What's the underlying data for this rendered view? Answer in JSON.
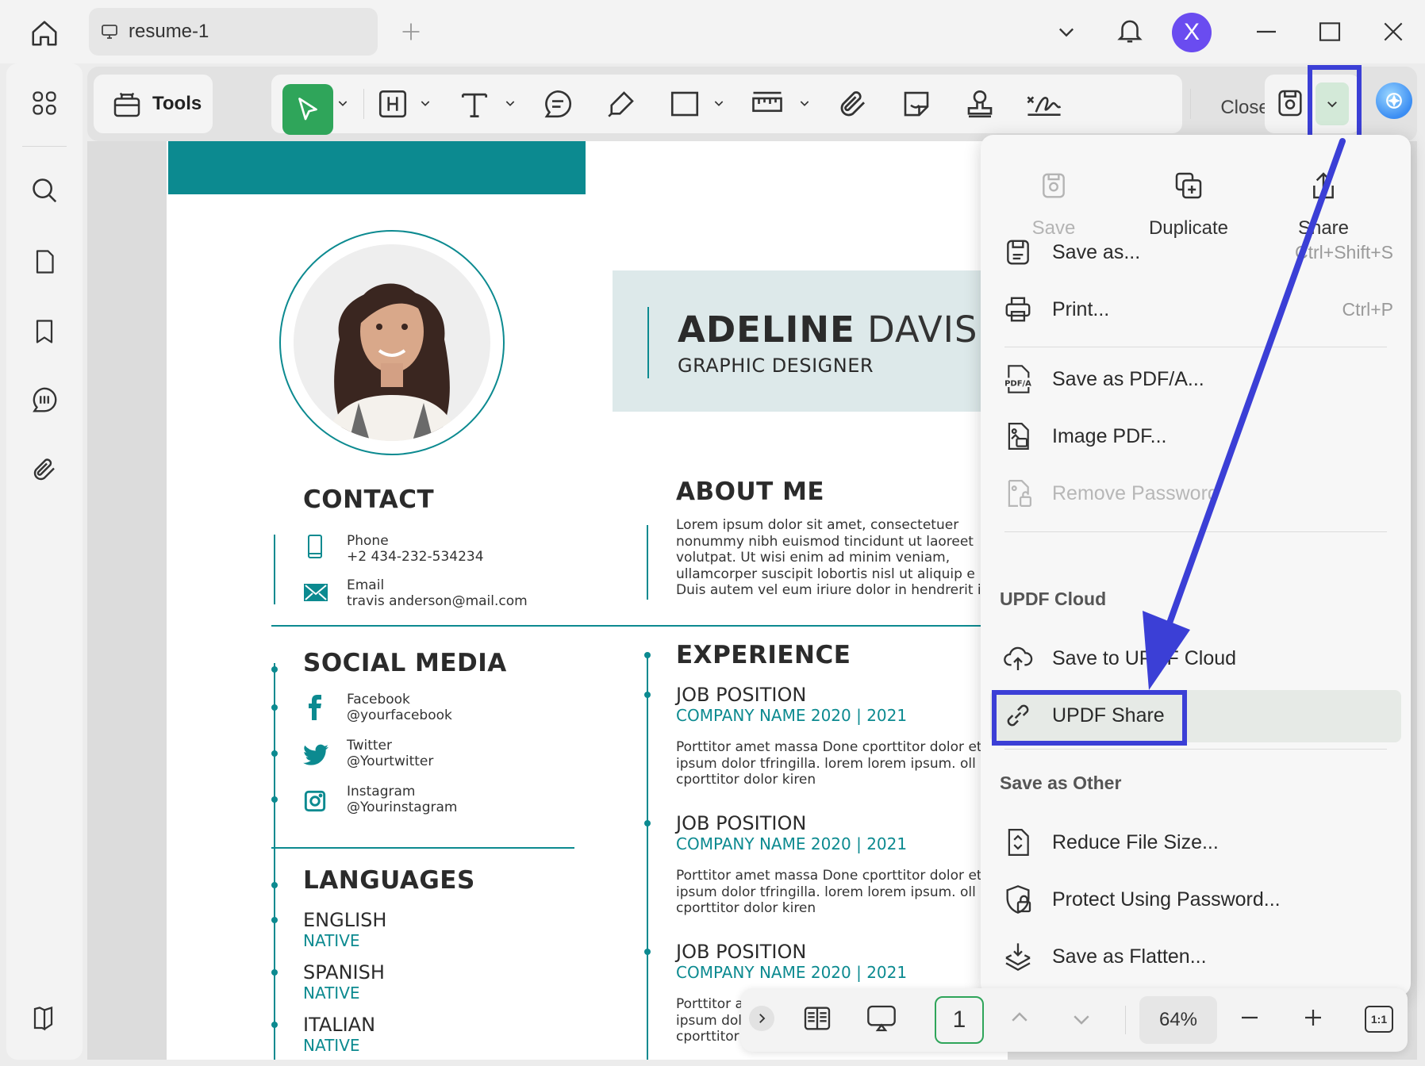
{
  "window": {
    "tab_title": "resume-1",
    "avatar_letter": "X",
    "avatar_color": "#6a4cf0"
  },
  "toolbar": {
    "tools_label": "Tools",
    "close_label": "Close",
    "accent_color": "#2fa55a"
  },
  "resume": {
    "first_name": "ADELINE",
    "last_name": "DAVIS",
    "job_title": "GRAPHIC DESIGNER",
    "contact": {
      "heading": "CONTACT",
      "phone_label": "Phone",
      "phone_value": "+2 434-232-534234",
      "email_label": "Email",
      "email_value": "travis anderson@mail.com"
    },
    "about": {
      "heading": "ABOUT ME",
      "text": "Lorem ipsum dolor sit amet, consectetuer\nnonummy nibh euismod tincidunt ut laoreet\nvolutpat. Ut wisi enim ad minim veniam,\nullamcorper suscipit lobortis nisl ut aliquip e\nDuis autem vel eum iriure dolor in hendrerit in"
    },
    "social": {
      "heading": "SOCIAL MEDIA",
      "items": [
        {
          "name": "Facebook",
          "handle": "@yourfacebook"
        },
        {
          "name": "Twitter",
          "handle": "@Yourtwitter"
        },
        {
          "name": "Instagram",
          "handle": "@Yourinstagram"
        }
      ]
    },
    "languages": {
      "heading": "LANGUAGES",
      "items": [
        {
          "name": "ENGLISH",
          "level": "NATIVE"
        },
        {
          "name": "SPANISH",
          "level": "NATIVE"
        },
        {
          "name": "ITALIAN",
          "level": "NATIVE"
        }
      ]
    },
    "experience": {
      "heading": "EXPERIENCE",
      "jobs": [
        {
          "position": "JOB POSITION",
          "company": "COMPANY NAME 2020 | 2021",
          "text": "Porttitor amet massa Done cporttitor dolor et l\nipsum dolor tfringilla. lorem lorem ipsum. oll\ncporttitor dolor kiren"
        },
        {
          "position": "JOB POSITION",
          "company": "COMPANY NAME 2020 | 2021",
          "text": "Porttitor amet massa Done cporttitor dolor et l\nipsum dolor tfringilla. lorem lorem ipsum. oll\ncporttitor dolor kiren"
        },
        {
          "position": "JOB POSITION",
          "company": "COMPANY NAME 2020 | 2021",
          "text": "Porttitor ar\nipsum dol\ncporttitor"
        }
      ]
    }
  },
  "menu": {
    "top_actions": [
      {
        "label": "Save",
        "disabled": true
      },
      {
        "label": "Duplicate",
        "disabled": false
      },
      {
        "label": "Share",
        "disabled": false
      }
    ],
    "save_as": {
      "label": "Save as...",
      "shortcut": "Ctrl+Shift+S"
    },
    "print": {
      "label": "Print...",
      "shortcut": "Ctrl+P"
    },
    "save_pdfa": {
      "label": "Save as PDF/A..."
    },
    "image_pdf": {
      "label": "Image PDF..."
    },
    "remove_password": {
      "label": "Remove Password"
    },
    "cloud_section": "UPDF Cloud",
    "save_cloud": {
      "label": "Save to UPDF Cloud"
    },
    "updf_share": {
      "label": "UPDF Share"
    },
    "other_section": "Save as Other",
    "reduce_size": {
      "label": "Reduce File Size..."
    },
    "protect": {
      "label": "Protect Using Password..."
    },
    "flatten": {
      "label": "Save as Flatten..."
    },
    "highlight_color": "#3b3fd6"
  },
  "bottombar": {
    "page_number": "1",
    "zoom": "64%",
    "fit_label": "1:1"
  },
  "colors": {
    "teal": "#0c8a90"
  }
}
